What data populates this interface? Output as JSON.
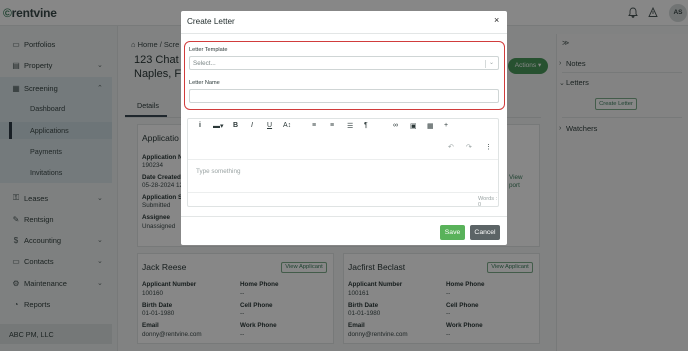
{
  "app": {
    "logo_text": "rentvine",
    "avatar_initials": "AS"
  },
  "sidebar": {
    "items": [
      {
        "label": "Portfolios",
        "icon": "briefcase-icon"
      },
      {
        "label": "Property",
        "icon": "building-icon"
      },
      {
        "label": "Screening",
        "icon": "clipboard-icon"
      },
      {
        "label": "Leases",
        "icon": "key-icon"
      },
      {
        "label": "Rentsign",
        "icon": "pen-icon"
      },
      {
        "label": "Accounting",
        "icon": "dollar-icon"
      },
      {
        "label": "Contacts",
        "icon": "contacts-icon"
      },
      {
        "label": "Maintenance",
        "icon": "wrench-icon"
      },
      {
        "label": "Reports",
        "icon": "chart-icon"
      }
    ],
    "screening_sub": [
      "Dashboard",
      "Applications",
      "Payments",
      "Invitations"
    ],
    "active_sub": "Applications",
    "company": "ABC PM, LLC"
  },
  "page": {
    "breadcrumb_home": "Home",
    "breadcrumb_next": "Scre",
    "address_line1": "123 Chat C",
    "address_line2": "Naples, FL",
    "actions_label": "Actions",
    "tab_details": "Details",
    "application_card": {
      "title": "Applicatio",
      "fields": [
        {
          "label": "Application N",
          "value": "190234"
        },
        {
          "label": "Date Created",
          "value": "05-28-2024 12"
        },
        {
          "label": "Application St",
          "value": "Submitted"
        },
        {
          "label": "Assignee",
          "value": "Unassigned"
        }
      ],
      "partial_right_1": "View",
      "partial_right_2": "port"
    },
    "applicants": [
      {
        "name": "Jack Reese",
        "view_label": "View Applicant",
        "number_label": "Applicant Number",
        "number": "100160",
        "home_phone_label": "Home Phone",
        "home_phone": "--",
        "birth_label": "Birth Date",
        "birth": "01-01-1980",
        "cell_label": "Cell Phone",
        "cell": "--",
        "email_label": "Email",
        "email": "donny@rentvine.com",
        "work_label": "Work Phone",
        "work": "--"
      },
      {
        "name": "Jacfirst Beclast",
        "view_label": "View Applicant",
        "number_label": "Applicant Number",
        "number": "100161",
        "home_phone_label": "Home Phone",
        "home_phone": "--",
        "birth_label": "Birth Date",
        "birth": "01-01-1980",
        "cell_label": "Cell Phone",
        "cell": "--",
        "email_label": "Email",
        "email": "donny@rentvine.com",
        "work_label": "Work Phone",
        "work": "--"
      }
    ]
  },
  "right_panel": {
    "collapse_icon": "double-chevron-right-icon",
    "notes": "Notes",
    "letters": "Letters",
    "create_letter": "Create Letter",
    "watchers": "Watchers"
  },
  "modal": {
    "title": "Create Letter",
    "close": "×",
    "template_label": "Letter Template",
    "template_placeholder": "Select...",
    "name_label": "Letter Name",
    "name_value": "",
    "editor_placeholder": "Type something",
    "word_count": "Words : 0",
    "save_label": "Save",
    "cancel_label": "Cancel"
  },
  "colors": {
    "highlight": "#d13c3c",
    "save": "#59b25a",
    "cancel": "#5c6466",
    "actions": "#4a9a5c",
    "accent_green": "#3b7d5c"
  }
}
